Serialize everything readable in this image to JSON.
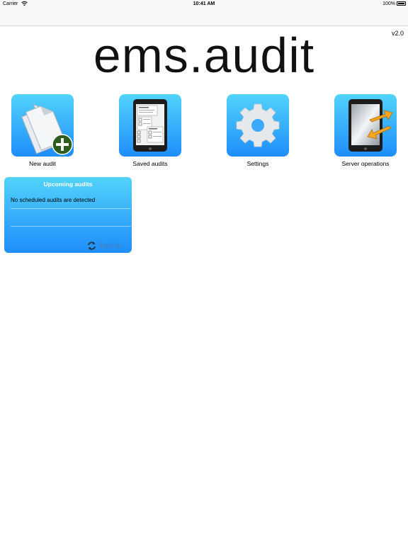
{
  "status_bar": {
    "carrier": "Carrier",
    "time": "10:41 AM",
    "battery": "100%"
  },
  "app": {
    "version": "v2.0",
    "logo": "ems.audit"
  },
  "tiles": [
    {
      "label": "New audit",
      "icon": "new-document-icon"
    },
    {
      "label": "Saved audits",
      "icon": "tablet-list-icon"
    },
    {
      "label": "Settings",
      "icon": "gear-icon"
    },
    {
      "label": "Server operations",
      "icon": "tablet-sync-icon"
    }
  ],
  "upcoming": {
    "title": "Upcoming audits",
    "message": "No scheduled audits are detected",
    "refresh_label": "Refresh"
  },
  "colors": {
    "tile_top": "#52d3fb",
    "tile_bottom": "#1f8dfb",
    "arrow_orange": "#f5a623",
    "plus_green": "#2f5d1e"
  }
}
